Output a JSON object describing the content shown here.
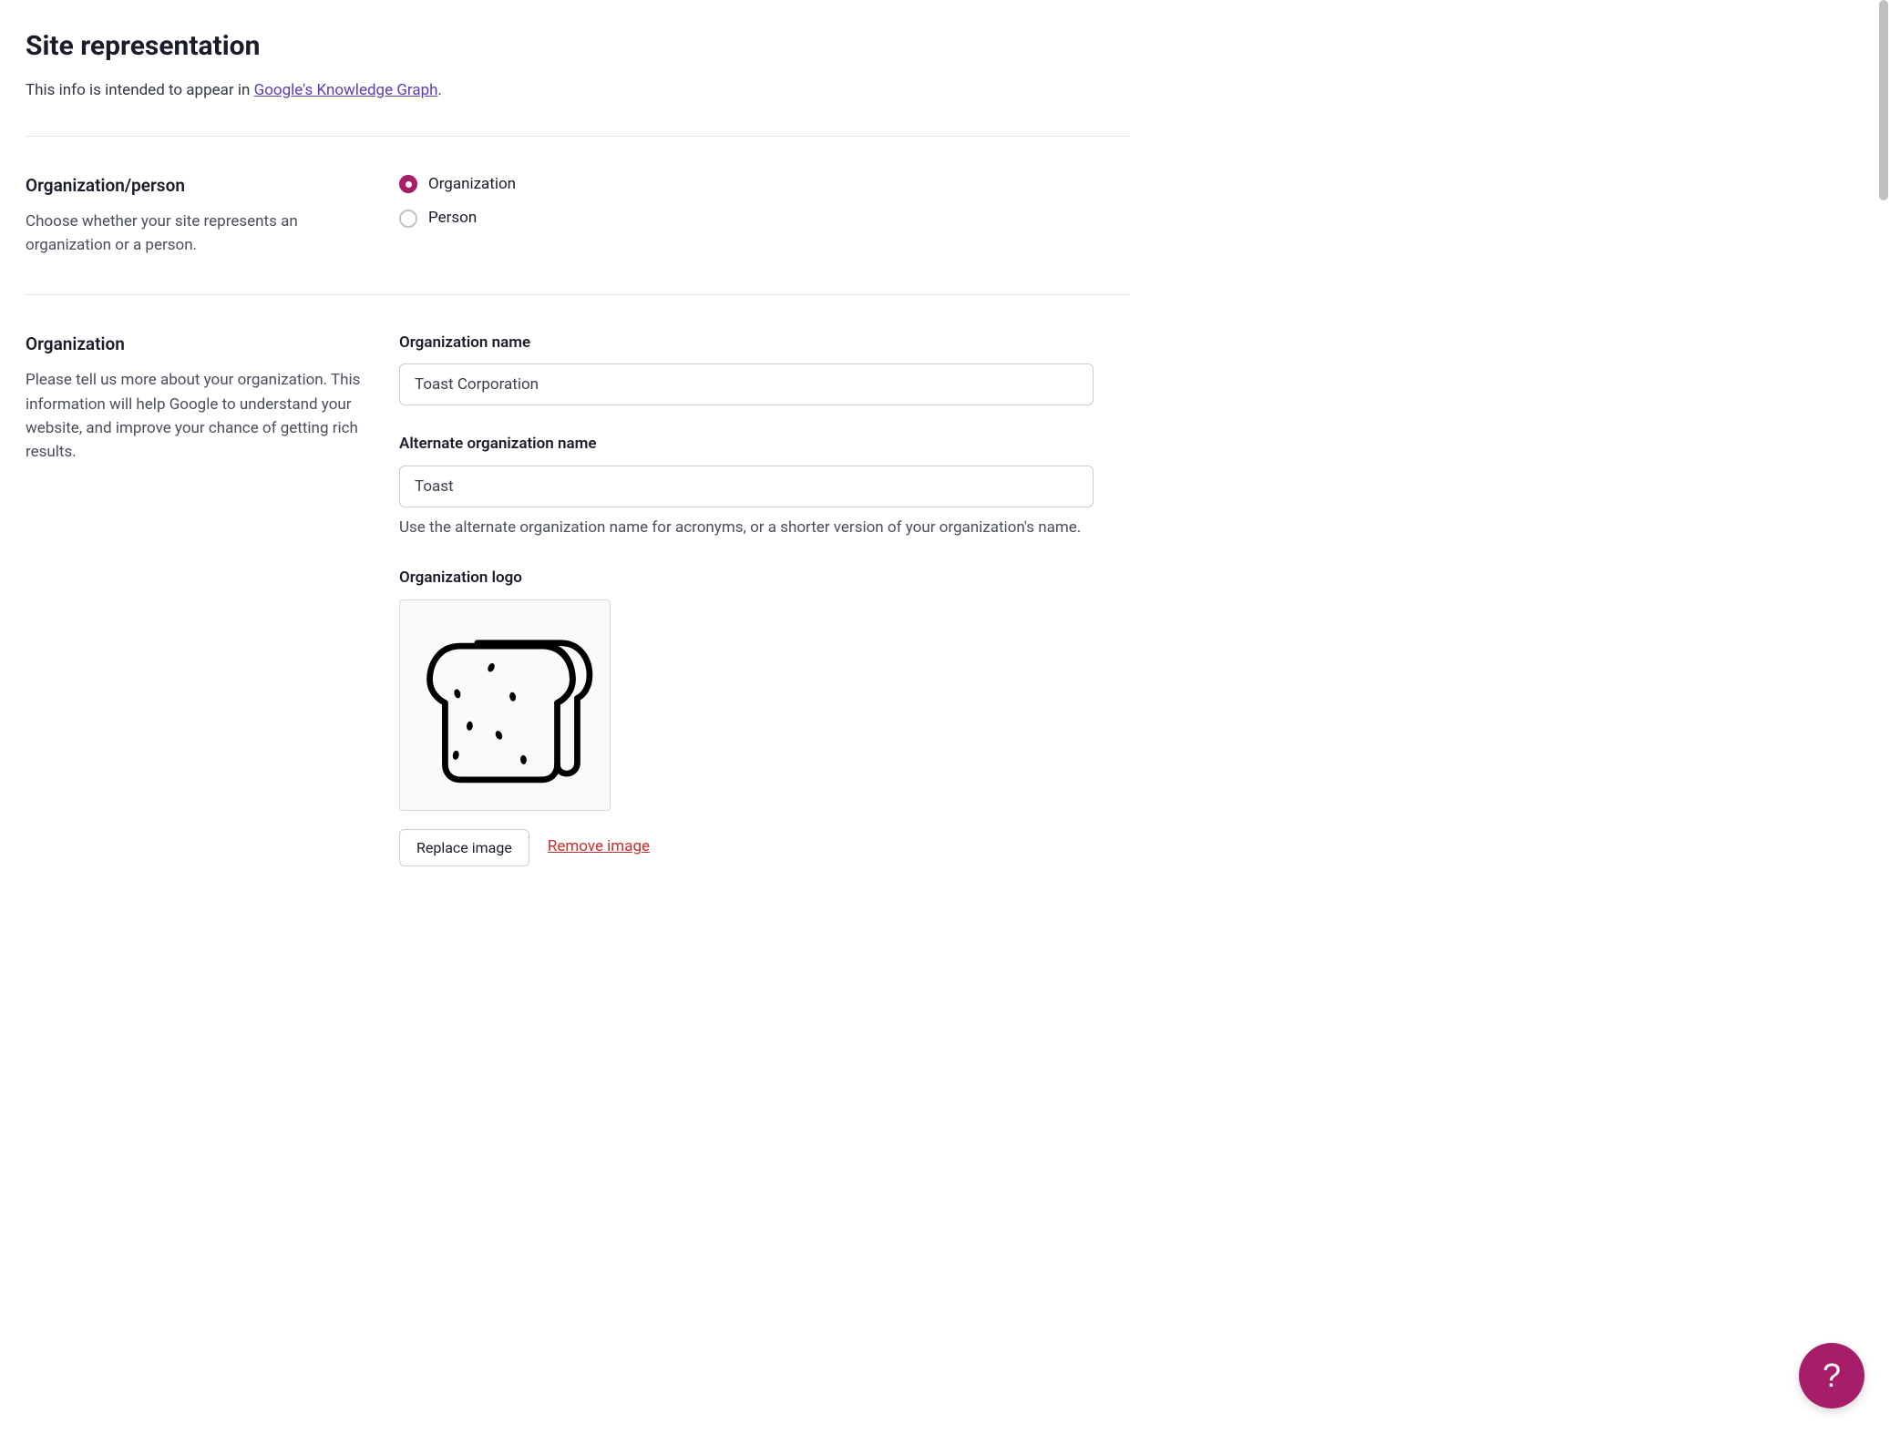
{
  "header": {
    "title": "Site representation",
    "intro_prefix": "This info is intended to appear in ",
    "intro_link": "Google's Knowledge Graph",
    "intro_suffix": "."
  },
  "orgPerson": {
    "heading": "Organization/person",
    "description": "Choose whether your site represents an organization or a person.",
    "options": {
      "organization": "Organization",
      "person": "Person"
    },
    "selected": "organization"
  },
  "organization": {
    "heading": "Organization",
    "description": "Please tell us more about your organization. This information will help Google to understand your website, and improve your chance of getting rich results.",
    "name": {
      "label": "Organization name",
      "value": "Toast Corporation"
    },
    "altName": {
      "label": "Alternate organization name",
      "value": "Toast",
      "help": "Use the alternate organization name for acronyms, or a shorter version of your organization's name."
    },
    "logo": {
      "label": "Organization logo",
      "replace": "Replace image",
      "remove": "Remove image"
    }
  },
  "help": {
    "glyph": "?"
  }
}
